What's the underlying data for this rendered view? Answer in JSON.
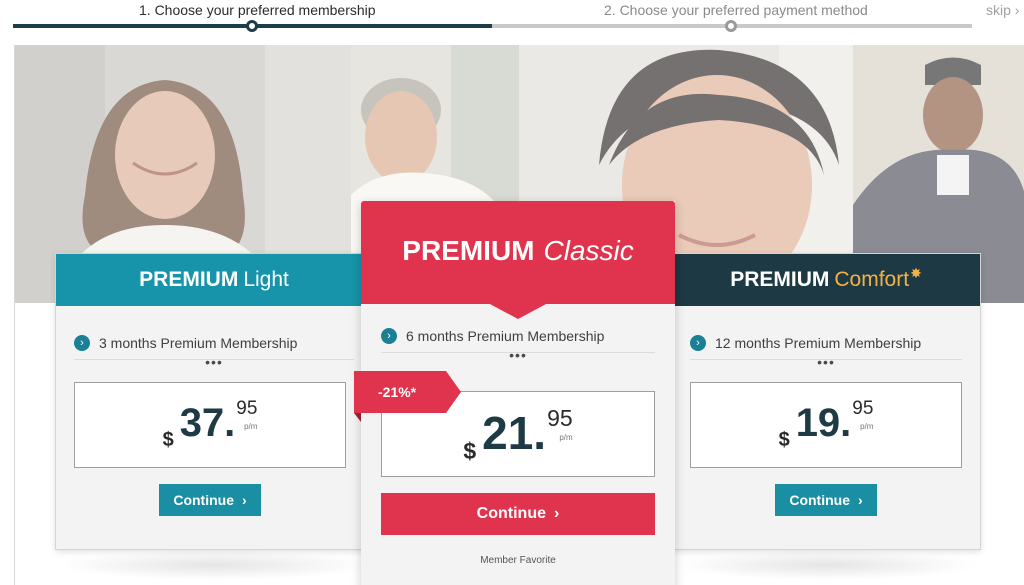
{
  "steps": {
    "step1_label": "1. Choose your preferred membership",
    "step2_label": "2. Choose your preferred payment method",
    "skip_label": "skip"
  },
  "plans": {
    "light": {
      "title_main": "PREMIUM",
      "title_sub": "Light",
      "feature": "3 months Premium Membership",
      "more": "•••",
      "currency": "$",
      "amount": "37.",
      "cents": "95",
      "period": "p/m",
      "cta": "Continue"
    },
    "classic": {
      "title_main": "PREMIUM",
      "title_sub": "Classic",
      "feature": "6 months Premium Membership",
      "more": "•••",
      "discount": "-21%*",
      "currency": "$",
      "amount": "21.",
      "cents": "95",
      "period": "p/m",
      "cta": "Continue",
      "note": "Member Favorite"
    },
    "comfort": {
      "title_main": "PREMIUM",
      "title_sub": "Comfort",
      "feature": "12 months Premium Membership",
      "more": "•••",
      "currency": "$",
      "amount": "19.",
      "cents": "95",
      "period": "p/m",
      "cta": "Continue"
    }
  },
  "icons": {
    "feature_bullet": "chevron-right-circle-icon",
    "continue_arrow": "chevron-right-icon",
    "sparkle": "sparkle-icon"
  },
  "colors": {
    "teal": "#1794a9",
    "dark_teal": "#1d3944",
    "red": "#e0344e",
    "gold": "#f3b344",
    "progress_done": "#1e3d4a",
    "progress_todo": "#c9c9c9"
  }
}
